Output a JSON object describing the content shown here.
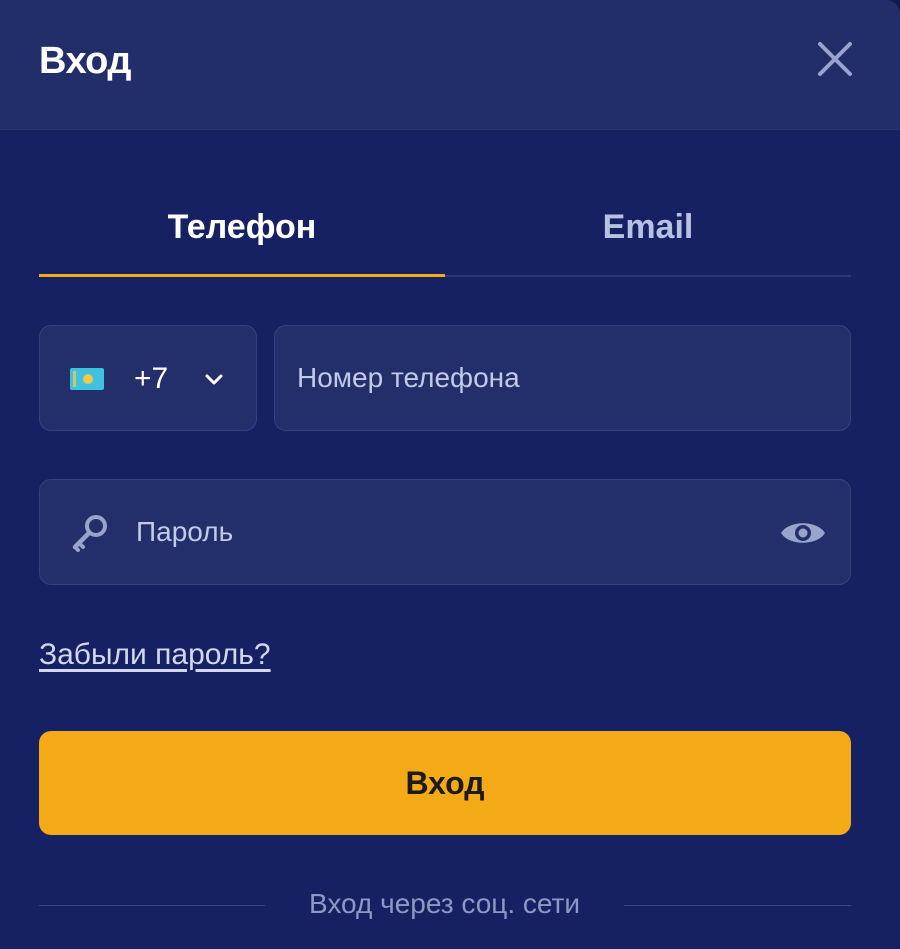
{
  "header": {
    "title": "Вход",
    "close_icon": "close-icon"
  },
  "tabs": [
    {
      "label": "Телефон",
      "active": true
    },
    {
      "label": "Email",
      "active": false
    }
  ],
  "phone": {
    "country_flag": "kazakhstan-flag-icon",
    "country_code": "+7",
    "placeholder": "Номер телефона",
    "value": ""
  },
  "password": {
    "placeholder": "Пароль",
    "value": "",
    "key_icon": "key-icon",
    "visibility_icon": "eye-icon"
  },
  "forgot_password_label": "Забыли пароль?",
  "submit_label": "Вход",
  "social_login_label": "Вход через соц. сети",
  "colors": {
    "accent": "#f4a916",
    "background": "#152163",
    "header": "#222e6a",
    "field": "#232f6b"
  }
}
